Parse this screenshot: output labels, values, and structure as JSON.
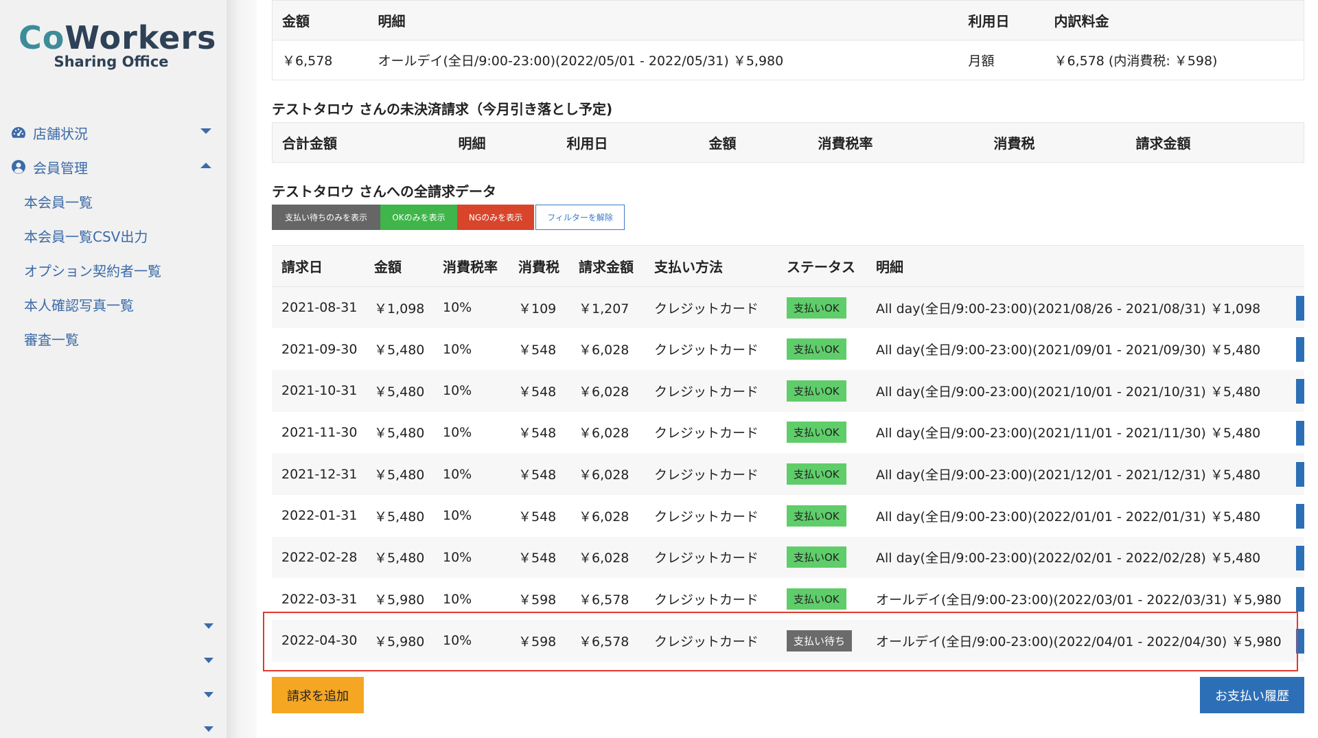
{
  "logo": {
    "co": "Co",
    "workers": "Workers",
    "subtitle": "Sharing Office"
  },
  "sidebar": {
    "items": [
      {
        "label": "店舗状況",
        "icon": "dashboard-icon",
        "caret": "down"
      },
      {
        "label": "会員管理",
        "icon": "user-circle-icon",
        "caret": "up"
      }
    ],
    "subitems": [
      "本会員一覧",
      "本会員一覧CSV出力",
      "オプション契約者一覧",
      "本人確認写真一覧",
      "審査一覧"
    ]
  },
  "contract_table": {
    "headers": [
      "金額",
      "明細",
      "利用日",
      "内訳料金"
    ],
    "row": [
      "￥6,578",
      "オールデイ(全日/9:00-23:00)(2022/05/01 - 2022/05/31) ￥5,980",
      "月額",
      "￥6,578 (内消費税: ￥598)"
    ]
  },
  "unpaid_section": {
    "title": "テストタロウ さんの未決済請求（今月引き落とし予定)",
    "headers": [
      "合計金額",
      "明細",
      "利用日",
      "金額",
      "消費税率",
      "消費税",
      "請求金額"
    ]
  },
  "all_billing_section": {
    "title": "テストタロウ さんへの全請求データ",
    "filters": [
      "支払い待ちのみを表示",
      "OKのみを表示",
      "NGのみを表示",
      "フィルターを解除"
    ],
    "headers": [
      "請求日",
      "金額",
      "消費税率",
      "消費税",
      "請求金額",
      "支払い方法",
      "ステータス",
      "明細"
    ],
    "rows": [
      [
        "2021-08-31",
        "￥1,098",
        "10%",
        "￥109",
        "￥1,207",
        "クレジットカード",
        "支払いOK",
        "All day(全日/9:00-23:00)(2021/08/26 - 2021/08/31) ￥1,098"
      ],
      [
        "2021-09-30",
        "￥5,480",
        "10%",
        "￥548",
        "￥6,028",
        "クレジットカード",
        "支払いOK",
        "All day(全日/9:00-23:00)(2021/09/01 - 2021/09/30) ￥5,480"
      ],
      [
        "2021-10-31",
        "￥5,480",
        "10%",
        "￥548",
        "￥6,028",
        "クレジットカード",
        "支払いOK",
        "All day(全日/9:00-23:00)(2021/10/01 - 2021/10/31) ￥5,480"
      ],
      [
        "2021-11-30",
        "￥5,480",
        "10%",
        "￥548",
        "￥6,028",
        "クレジットカード",
        "支払いOK",
        "All day(全日/9:00-23:00)(2021/11/01 - 2021/11/30) ￥5,480"
      ],
      [
        "2021-12-31",
        "￥5,480",
        "10%",
        "￥548",
        "￥6,028",
        "クレジットカード",
        "支払いOK",
        "All day(全日/9:00-23:00)(2021/12/01 - 2021/12/31) ￥5,480"
      ],
      [
        "2022-01-31",
        "￥5,480",
        "10%",
        "￥548",
        "￥6,028",
        "クレジットカード",
        "支払いOK",
        "All day(全日/9:00-23:00)(2022/01/01 - 2022/01/31) ￥5,480"
      ],
      [
        "2022-02-28",
        "￥5,480",
        "10%",
        "￥548",
        "￥6,028",
        "クレジットカード",
        "支払いOK",
        "All day(全日/9:00-23:00)(2022/02/01 - 2022/02/28) ￥5,480"
      ],
      [
        "2022-03-31",
        "￥5,980",
        "10%",
        "￥598",
        "￥6,578",
        "クレジットカード",
        "支払いOK",
        "オールデイ(全日/9:00-23:00)(2022/03/01 - 2022/03/31) ￥5,980"
      ],
      [
        "2022-04-30",
        "￥5,980",
        "10%",
        "￥598",
        "￥6,578",
        "クレジットカード",
        "支払い待ち",
        "オールデイ(全日/9:00-23:00)(2022/04/01 - 2022/04/30) ￥5,980"
      ]
    ]
  },
  "buttons": {
    "add_billing": "請求を追加",
    "payment_history": "お支払い履歴"
  },
  "colors": {
    "brand_dark": "#2e4156",
    "brand_teal": "#3d8c9a",
    "link_blue": "#3b6aa8",
    "status_ok": "#5fcd6a",
    "status_wait": "#6b6b6b",
    "highlight": "#e0382c",
    "primary": "#2d6fb7",
    "warning": "#f5a623"
  }
}
